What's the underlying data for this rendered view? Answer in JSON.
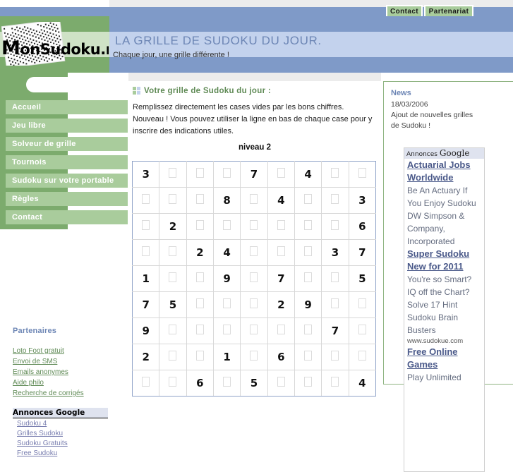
{
  "topbar": {
    "buttons": [
      {
        "label": "Contact",
        "name": "contact"
      },
      {
        "label": "Partenariat",
        "name": "partenariat"
      }
    ]
  },
  "header": {
    "logo_text_first": "M",
    "logo_text_rest": "onSudoku.net",
    "title": "LA GRILLE DE SUDOKU DU JOUR.",
    "subtitle": "Chaque jour, une grille différente !",
    "colors": {
      "green": "#7cab6d",
      "blue": "#7f9ac8",
      "light_green": "#cfe2c6",
      "light_blue": "#c3d2ed"
    }
  },
  "sidebar": {
    "menu": [
      {
        "label": "Accueil"
      },
      {
        "label": "Jeu libre"
      },
      {
        "label": "Solveur de grille"
      },
      {
        "label": "Tournois"
      },
      {
        "label": "Sudoku sur votre portable"
      },
      {
        "label": "Règles"
      },
      {
        "label": "Contact"
      }
    ],
    "partners_title": "Partenaires",
    "partners": [
      {
        "label": "Loto Foot gratuit"
      },
      {
        "label": "Envoi de SMS"
      },
      {
        "label": "Emails anonymes"
      },
      {
        "label": "Aide philo"
      },
      {
        "label": "Recherche de corrigés"
      }
    ],
    "google_ads_title": "Annonces Google",
    "google_ads": [
      {
        "label": "Sudoku 4"
      },
      {
        "label": "Grilles Sudoku"
      },
      {
        "label": "Sudoku Gratuits"
      },
      {
        "label": "Free Sudoku"
      }
    ]
  },
  "main": {
    "heading": "Votre grille de Sudoku du jour :",
    "intro": "Remplissez directement les cases vides par les bons chiffres. Nouveau ! Vous pouvez utiliser la ligne en bas de chaque case pour y inscrire des indications utiles.",
    "level": "niveau 2",
    "grid": [
      [
        "3",
        "",
        "",
        "",
        "7",
        "",
        "4",
        "",
        ""
      ],
      [
        "",
        "",
        "",
        "8",
        "",
        "4",
        "",
        "",
        "3"
      ],
      [
        "",
        "2",
        "",
        "",
        "",
        "",
        "",
        "",
        "6"
      ],
      [
        "",
        "",
        "2",
        "4",
        "",
        "",
        "",
        "3",
        "7"
      ],
      [
        "1",
        "",
        "",
        "9",
        "",
        "7",
        "",
        "",
        "5"
      ],
      [
        "7",
        "5",
        "",
        "",
        "",
        "2",
        "9",
        "",
        ""
      ],
      [
        "9",
        "",
        "",
        "",
        "",
        "",
        "",
        "7",
        ""
      ],
      [
        "2",
        "",
        "",
        "1",
        "",
        "6",
        "",
        "",
        ""
      ],
      [
        "",
        "",
        "6",
        "",
        "5",
        "",
        "",
        "",
        "4"
      ]
    ]
  },
  "news": {
    "title": "News",
    "date": "18/03/2006",
    "body": "Ajout de nouvelles grilles de Sudoku !"
  },
  "ads": {
    "header_label": "Annonces",
    "header_brand": "Google",
    "items": [
      {
        "title": "Actuarial Jobs Worldwide",
        "desc": "Be An Actuary If You Enjoy Sudoku DW Simpson & Company, Incorporated",
        "url": ""
      },
      {
        "title": "Super Sudoku New for 2011",
        "desc": "You're so Smart? IQ off the Chart? Solve 17 Hint Sudoku Brain Busters",
        "url": "www.sudokue.com"
      },
      {
        "title": "Free Online Games",
        "desc": "Play Unlimited",
        "url": ""
      }
    ]
  }
}
